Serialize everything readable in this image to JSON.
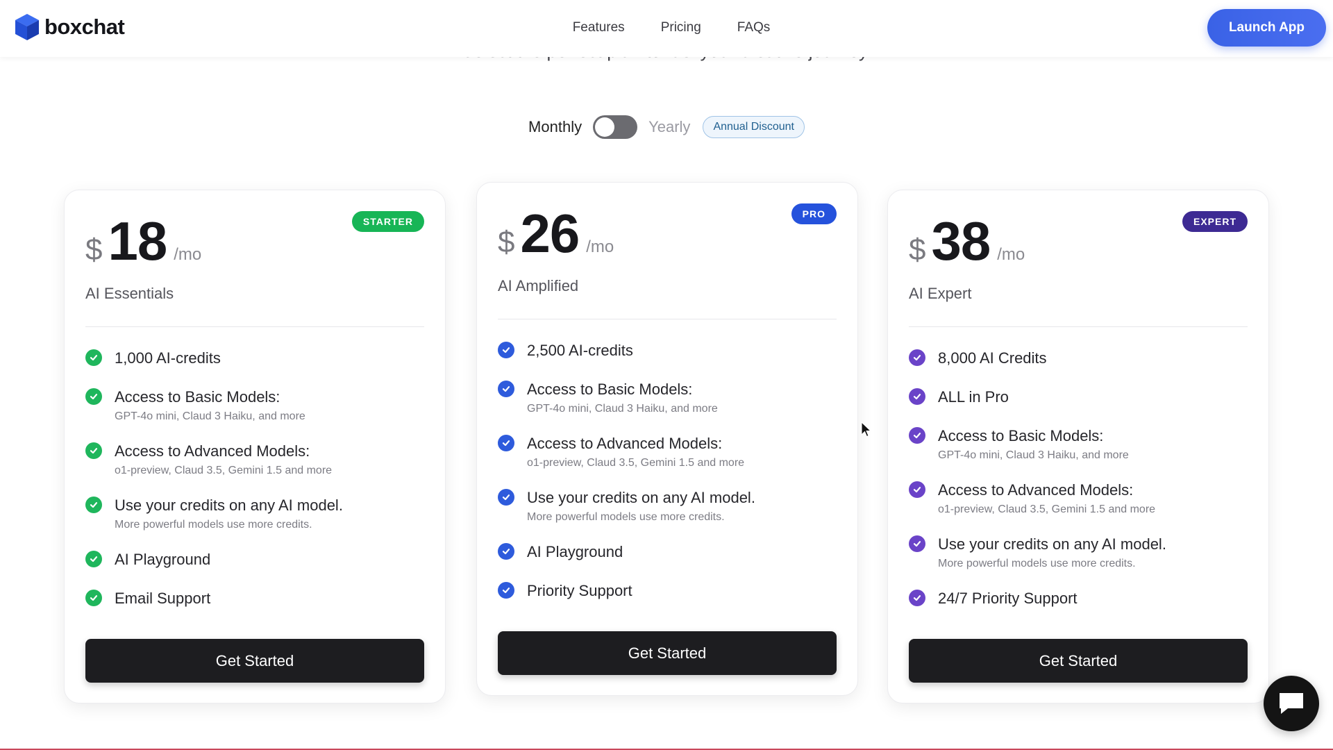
{
  "header": {
    "logo_text": "boxchat",
    "nav": [
      "Features",
      "Pricing",
      "FAQs"
    ],
    "launch_label": "Launch App"
  },
  "subtitle": "Select the perfect plan to fuel your creative journey.",
  "billing": {
    "monthly_label": "Monthly",
    "yearly_label": "Yearly",
    "discount_label": "Annual Discount",
    "yearly_enabled": false
  },
  "plans": [
    {
      "badge": "STARTER",
      "badge_color": "#17b556",
      "currency": "$",
      "price": "18",
      "period": "/mo",
      "name": "AI Essentials",
      "check_color": "#1fb65c",
      "features": [
        {
          "main": "1,000 AI-credits",
          "sub": ""
        },
        {
          "main": "Access to Basic Models:",
          "sub": "GPT-4o mini, Claud 3 Haiku, and more"
        },
        {
          "main": "Access to Advanced Models:",
          "sub": "o1-preview, Claud 3.5, Gemini 1.5 and more"
        },
        {
          "main": "Use your credits on any AI model.",
          "sub": "More powerful models use more credits."
        },
        {
          "main": "AI Playground",
          "sub": ""
        },
        {
          "main": "Email Support",
          "sub": ""
        }
      ],
      "cta": "Get Started"
    },
    {
      "badge": "PRO",
      "badge_color": "#2552dc",
      "currency": "$",
      "price": "26",
      "period": "/mo",
      "name": "AI Amplified",
      "check_color": "#2e5bdc",
      "features": [
        {
          "main": "2,500 AI-credits",
          "sub": ""
        },
        {
          "main": "Access to Basic Models:",
          "sub": "GPT-4o mini, Claud 3 Haiku, and more"
        },
        {
          "main": "Access to Advanced Models:",
          "sub": "o1-preview, Claud 3.5, Gemini 1.5 and more"
        },
        {
          "main": "Use your credits on any AI model.",
          "sub": "More powerful models use more credits."
        },
        {
          "main": "AI Playground",
          "sub": ""
        },
        {
          "main": "Priority Support",
          "sub": ""
        }
      ],
      "cta": "Get Started"
    },
    {
      "badge": "EXPERT",
      "badge_color": "#3d2a93",
      "currency": "$",
      "price": "38",
      "period": "/mo",
      "name": "AI Expert",
      "check_color": "#6a43c8",
      "features": [
        {
          "main": "8,000 AI Credits",
          "sub": ""
        },
        {
          "main": "ALL in Pro",
          "sub": ""
        },
        {
          "main": "Access to Basic Models:",
          "sub": "GPT-4o mini, Claud 3 Haiku, and more"
        },
        {
          "main": "Access to Advanced Models:",
          "sub": "o1-preview, Claud 3.5, Gemini 1.5 and more"
        },
        {
          "main": "Use your credits on any AI model.",
          "sub": "More powerful models use more credits."
        },
        {
          "main": "24/7 Priority Support",
          "sub": ""
        }
      ],
      "cta": "Get Started"
    }
  ],
  "icons": {
    "logo": "cube-logo-icon",
    "check": "check-circle-icon",
    "chat": "chat-bubble-icon",
    "cursor": "mouse-cursor-icon"
  }
}
